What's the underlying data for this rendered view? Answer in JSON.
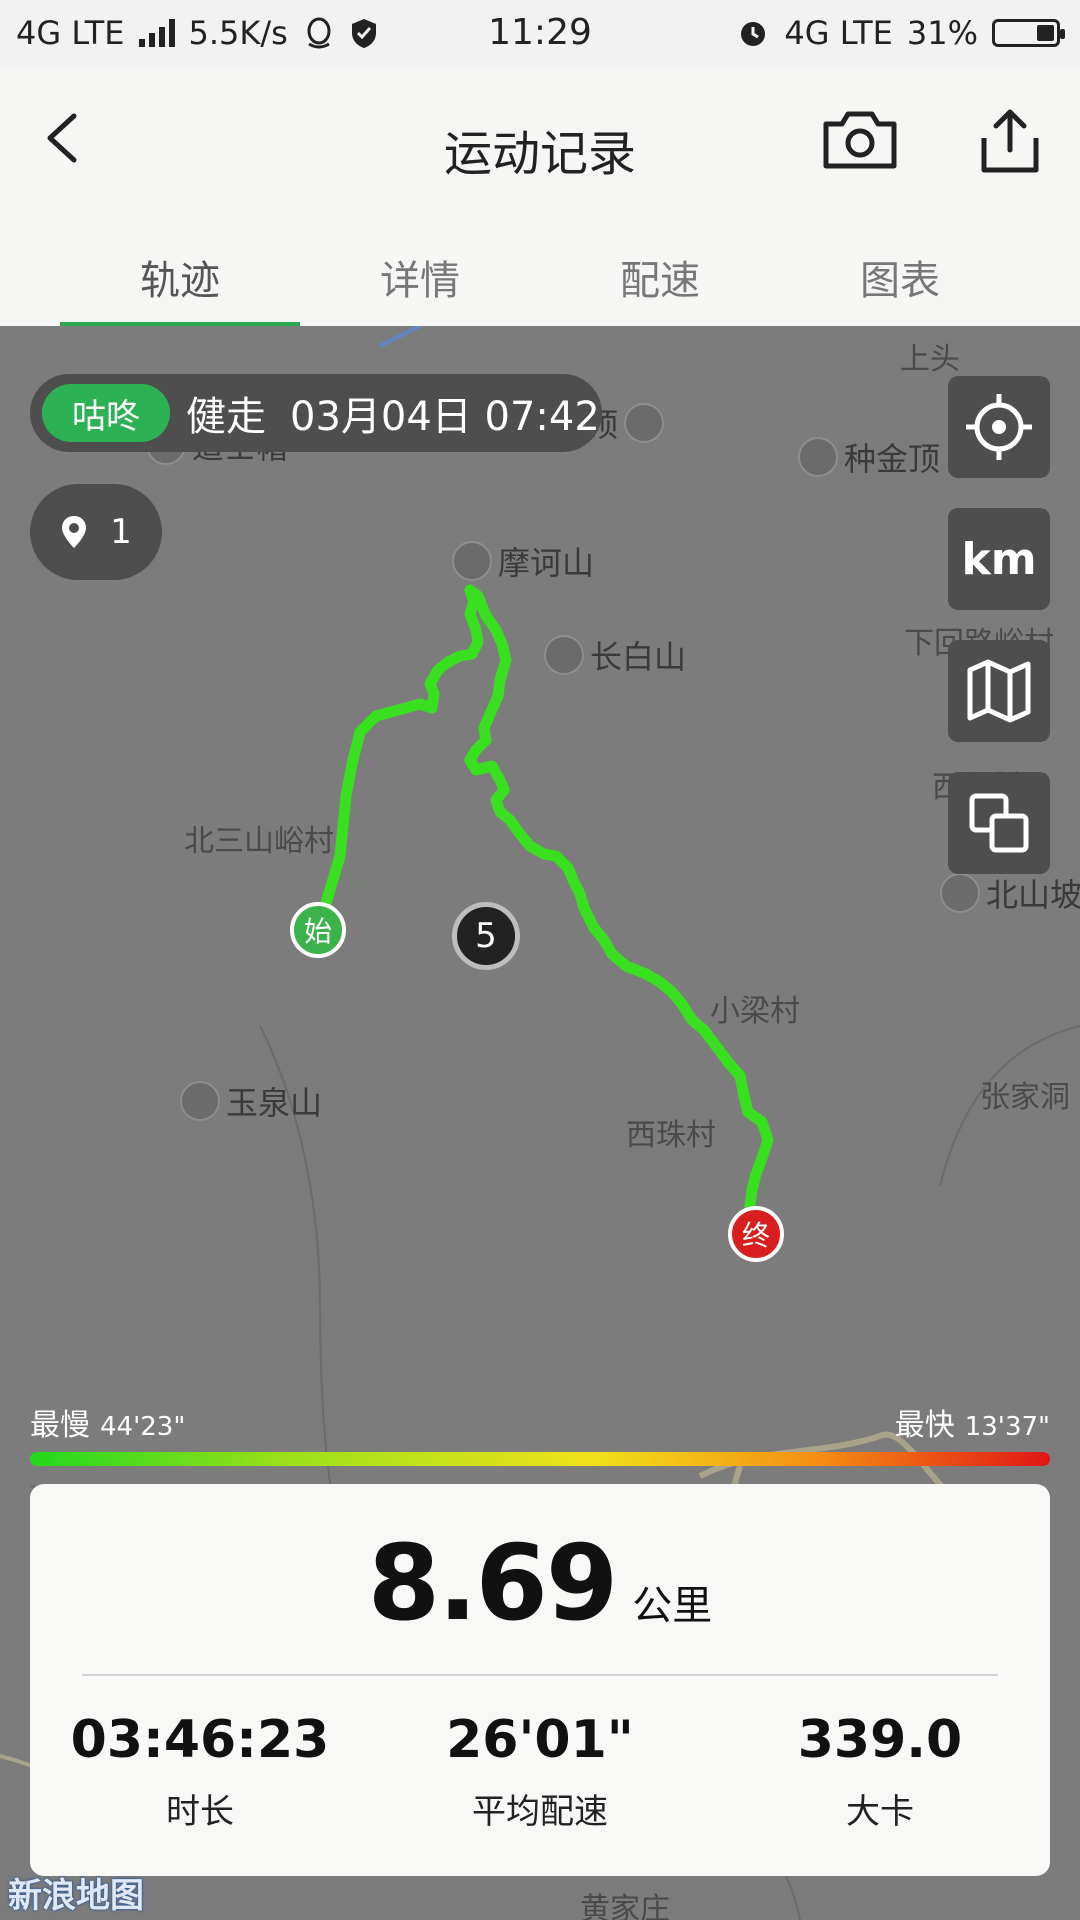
{
  "status_bar": {
    "network_left": "4G LTE",
    "speed": "5.5K/s",
    "time": "11:29",
    "network_right": "4G LTE",
    "battery": "31%",
    "battery_level": 0.31
  },
  "header": {
    "title": "运动记录",
    "back_icon": "chevron-left-icon",
    "camera_icon": "camera-icon",
    "share_icon": "share-icon"
  },
  "tabs": [
    {
      "label": "轨迹",
      "active": true
    },
    {
      "label": "详情",
      "active": false
    },
    {
      "label": "配速",
      "active": false
    },
    {
      "label": "图表",
      "active": false
    }
  ],
  "map": {
    "brand": "咕咚",
    "sport": "健走",
    "date": "03月04日 07:42",
    "pin_count": "1",
    "km_button": "km",
    "start_label": "始",
    "end_label": "终",
    "km_marker": "5",
    "places": {
      "p1": "道士帽",
      "p2": "劈尖顶",
      "p3": "种金顶",
      "p4": "摩诃山",
      "p5": "长白山",
      "p6": "下回路峪村",
      "p7": "西峪村",
      "p8": "北三山峪村",
      "p9": "北山坡",
      "p10": "小梁村",
      "p11": "张家洞",
      "p12": "玉泉山",
      "p13": "西珠村",
      "p14": "黄家庄",
      "p15": "上头"
    }
  },
  "pace": {
    "slowest_label": "最慢",
    "slowest": "44'23\"",
    "fastest_label": "最快",
    "fastest": "13'37\""
  },
  "summary": {
    "distance": "8.69",
    "distance_unit": "公里",
    "duration": "03:46:23",
    "duration_label": "时长",
    "avg_pace": "26'01\"",
    "avg_pace_label": "平均配速",
    "calories": "339.0",
    "calories_label": "大卡"
  },
  "watermark": "新浪地图",
  "colors": {
    "accent": "#2cb254",
    "track": "#39e01f",
    "end_marker": "#d81e1e"
  }
}
